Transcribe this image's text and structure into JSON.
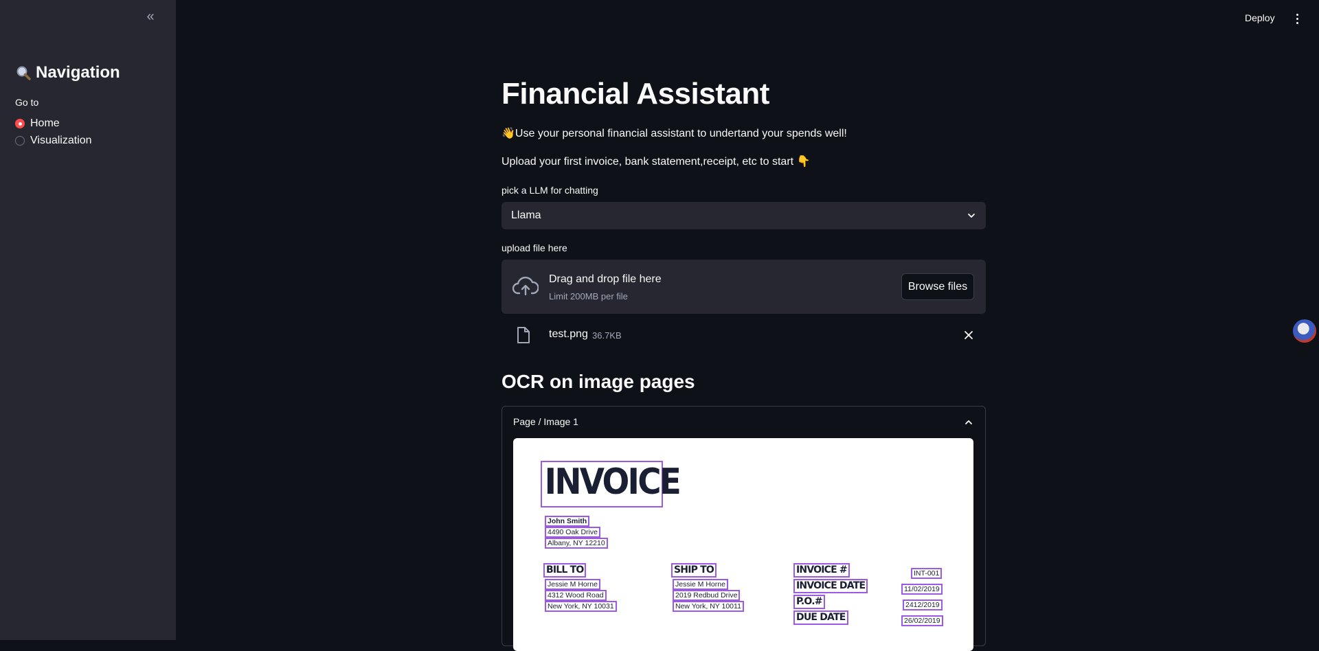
{
  "sidebar": {
    "collapse_icon": "«",
    "title": "Navigation",
    "goto_label": "Go to",
    "options": [
      {
        "label": "Home",
        "selected": true
      },
      {
        "label": "Visualization",
        "selected": false
      }
    ]
  },
  "topbar": {
    "deploy_label": "Deploy"
  },
  "main": {
    "title": "Financial Assistant",
    "intro": "👋Use your personal financial assistant to undertand your spends well!",
    "upload_hint": "Upload your first invoice, bank statement,receipt, etc to start 👇",
    "llm_label": "pick a LLM for chatting",
    "llm_selected": "Llama",
    "upload_label": "upload file here",
    "dropzone_title": "Drag and drop file here",
    "dropzone_limit": "Limit 200MB per file",
    "browse_label": "Browse files",
    "file": {
      "name": "test.png",
      "size": "36.7KB"
    },
    "ocr_title": "OCR on image pages",
    "expander_label": "Page / Image 1"
  },
  "invoice": {
    "title": "INVOICE",
    "from_name": "John Smith",
    "from_address1": "4490 Oak Drive",
    "from_address2": "Albany, NY 12210",
    "bill_to_label": "BILL TO",
    "bill_to_name": "Jessie M Horne",
    "bill_to_address1": "4312 Wood Road",
    "bill_to_address2": "New York, NY 10031",
    "ship_to_label": "SHIP TO",
    "ship_to_name": "Jessie M Horne",
    "ship_to_address1": "2019 Redbud Drive",
    "ship_to_address2": "New York, NY 10011",
    "invoice_no_label": "INVOICE #",
    "invoice_date_label": "INVOICE DATE",
    "po_label": "P.O.#",
    "due_date_label": "DUE DATE",
    "invoice_no": "INT-001",
    "invoice_date": "11/02/2019",
    "po": "2412/2019",
    "due_date": "26/02/2019"
  },
  "colors": {
    "accent": "#ff4b4b",
    "ocr_box": "#9b59e6",
    "background": "#0e1117",
    "sidebar": "#262730"
  }
}
